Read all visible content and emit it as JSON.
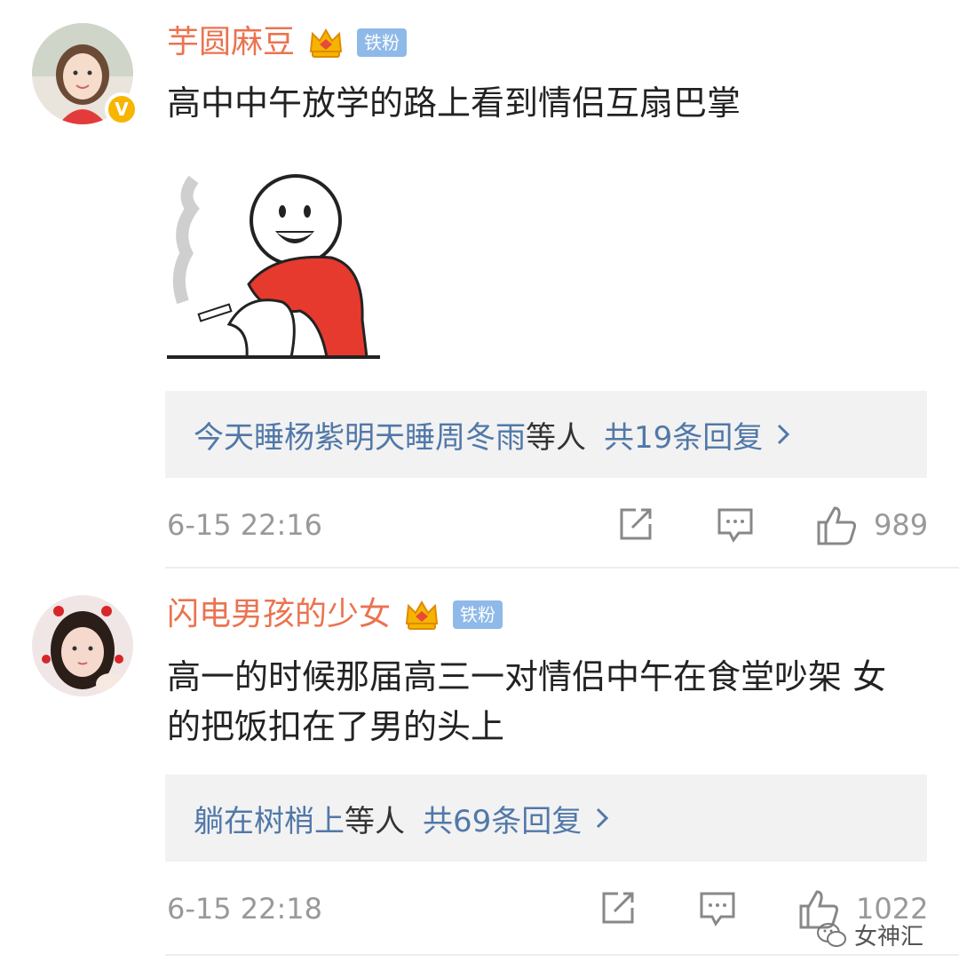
{
  "comments": [
    {
      "username": "芋圆麻豆",
      "fan_badge": "铁粉",
      "verified": "V",
      "text": "高中中午放学的路上看到情侣互扇巴掌",
      "reply_names": "今天睡杨紫明天睡周冬雨",
      "reply_etc": "等人",
      "reply_count": "共19条回复",
      "time": "6-15 22:16",
      "likes": "989"
    },
    {
      "username": "闪电男孩的少女",
      "fan_badge": "铁粉",
      "text": "高一的时候那届高三一对情侣中午在食堂吵架 女的把饭扣在了男的头上",
      "reply_names": "躺在树梢上",
      "reply_etc": "等人",
      "reply_count": "共69条回复",
      "time": "6-15 22:18",
      "likes": "1022"
    }
  ],
  "watermark": "女神汇",
  "colors": {
    "username": "#eb7350",
    "link": "#5178a8",
    "meta": "#999999",
    "fan_badge": "#8fb9e8"
  }
}
